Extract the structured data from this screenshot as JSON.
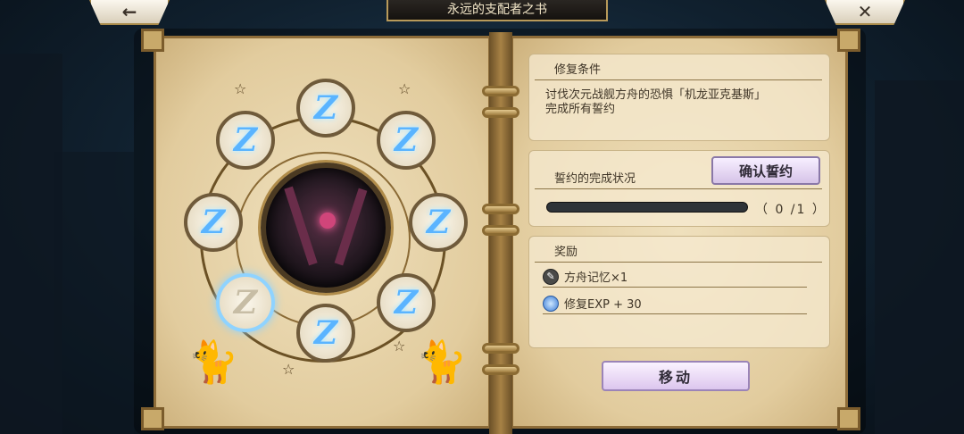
{
  "header": {
    "title": "永远的支配者之书",
    "back_icon": "←",
    "close_icon": "✕"
  },
  "runes": {
    "active_glyph": "Z",
    "slot_states": [
      "obtained",
      "obtained",
      "obtained",
      "obtained",
      "obtained",
      "obtained",
      "obtained",
      "empty"
    ]
  },
  "condition": {
    "title": "修复条件",
    "line1": "讨伐次元战舰方舟的恐惧「机龙亚克基斯」",
    "line2": "完成所有誓约"
  },
  "oath": {
    "title": "誓约的完成状况",
    "confirm_label": "确认誓约",
    "progress_text": "（ 0 /1 ）",
    "progress_fraction": 0
  },
  "reward": {
    "title": "奖励",
    "items": [
      {
        "label": "方舟记忆×1",
        "icon": "ark-memory-icon"
      },
      {
        "label": "修复EXP + 30",
        "icon": "repair-exp-icon"
      }
    ]
  },
  "move_label": "移动",
  "colors": {
    "rune_glow": "#5ab4ff",
    "book_frame": "#8d6c39",
    "button_purple": "#dcc6ee"
  }
}
